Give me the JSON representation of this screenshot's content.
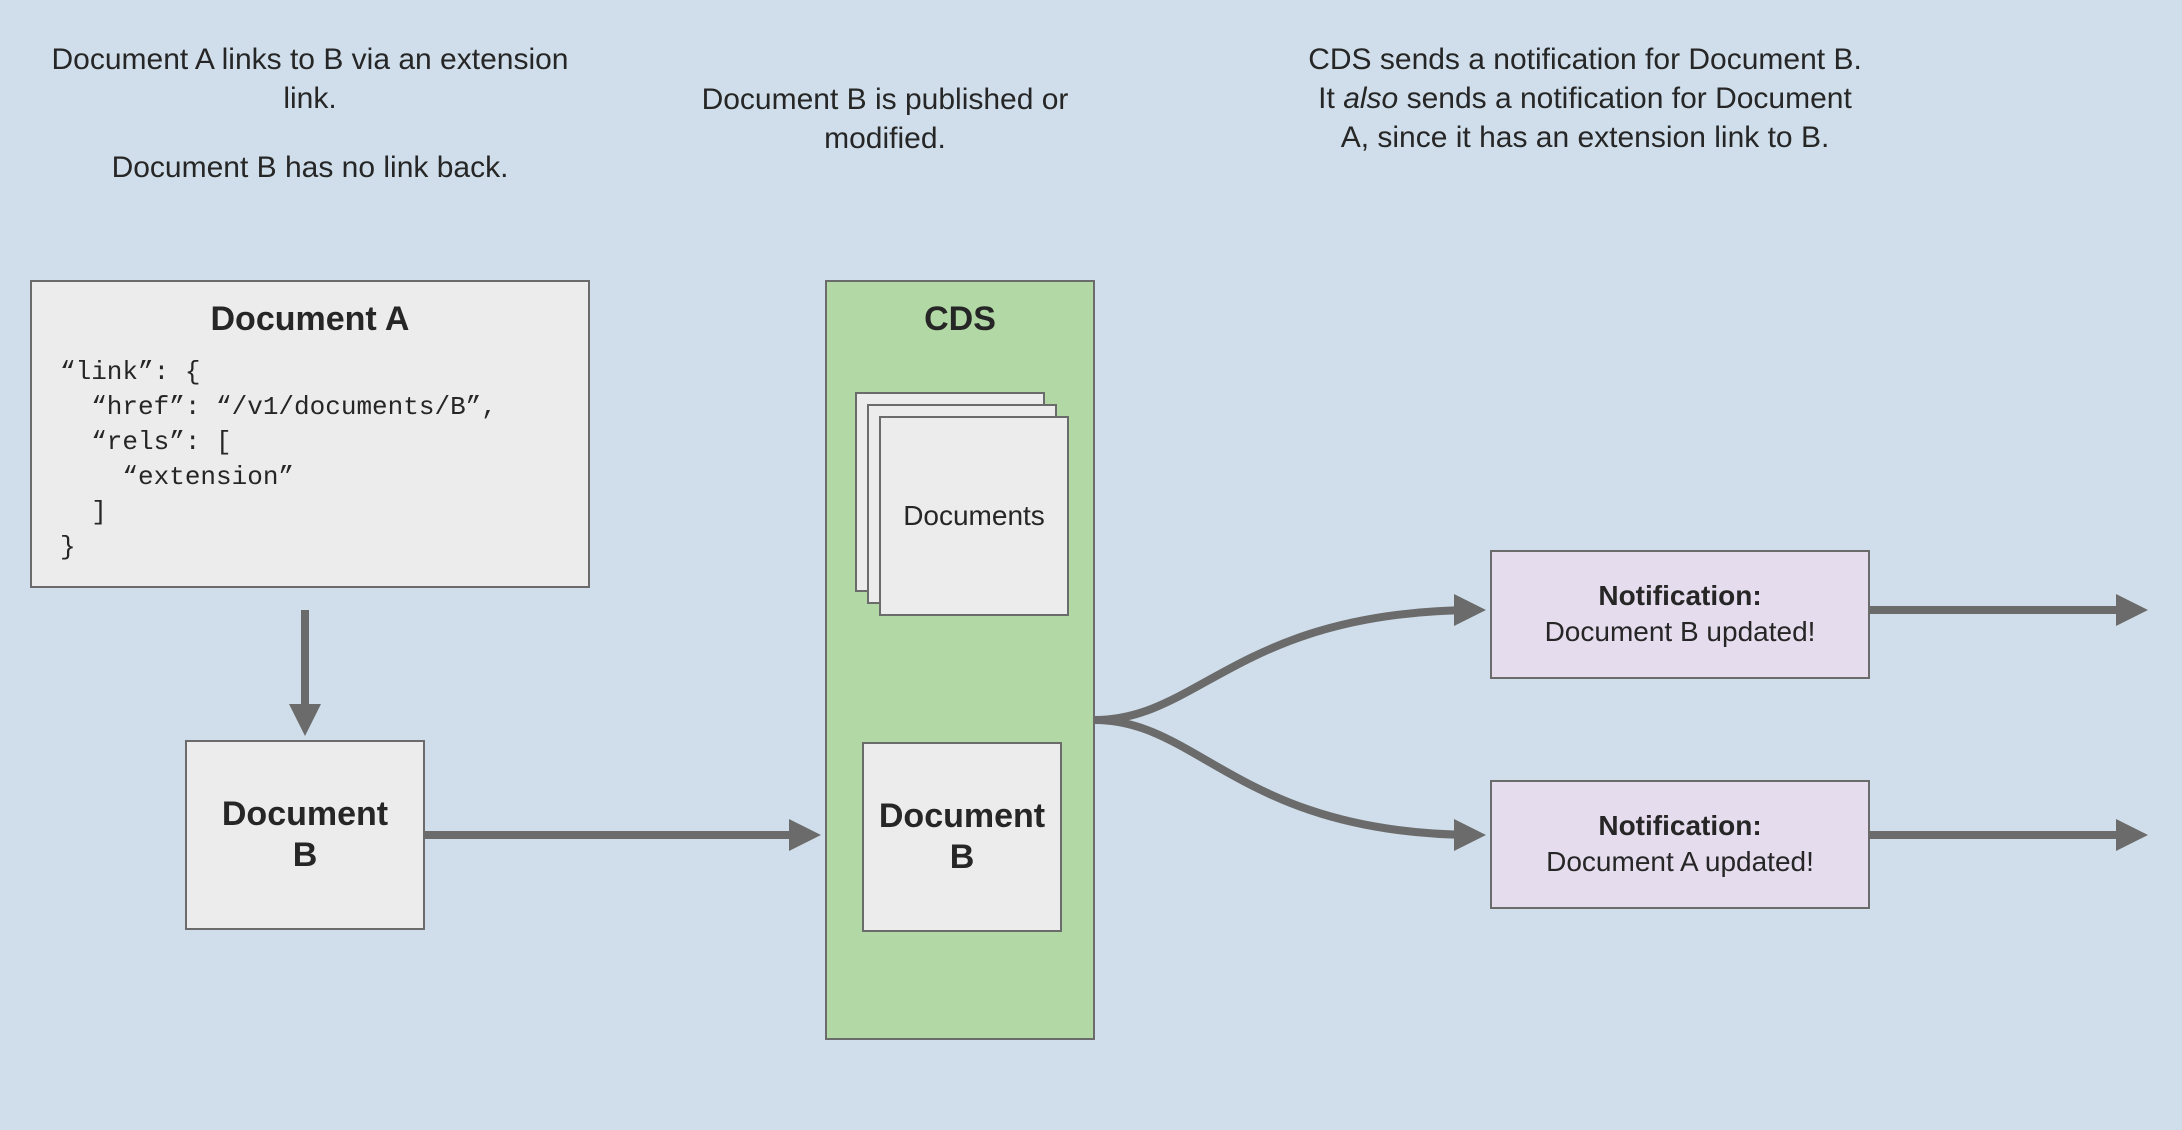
{
  "captions": {
    "left_1": "Document A links to B via an extension link.",
    "left_2": "Document B has no link back.",
    "middle": "Document B is published or modified.",
    "right_before": "CDS sends a notification for Document B. It ",
    "right_em": "also",
    "right_after": " sends a notification for Document A, since it has an extension link to B."
  },
  "doc_a": {
    "title": "Document A",
    "code": "“link”: {\n  “href”: “/v1/documents/B”,\n  “rels”: [\n    “extension”\n  ]\n}"
  },
  "doc_b_left": "Document\nB",
  "cds": {
    "title": "CDS",
    "stack_label": "Documents",
    "doc_b": "Document\nB"
  },
  "notifications": {
    "title": "Notification:",
    "b_text": "Document B updated!",
    "a_text": "Document A updated!"
  }
}
